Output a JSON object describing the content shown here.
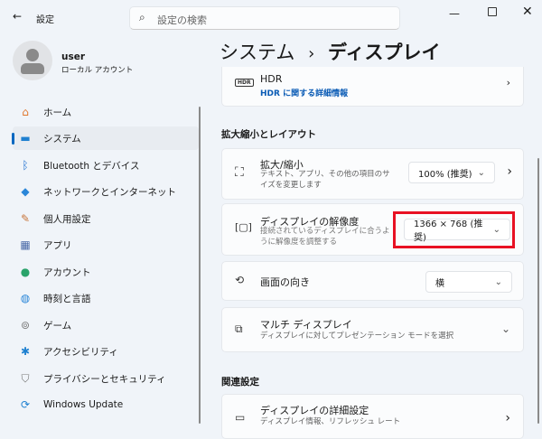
{
  "window": {
    "title": "設定",
    "search_placeholder": "設定の検索"
  },
  "user": {
    "name": "user",
    "account": "ローカル アカウント"
  },
  "nav": [
    {
      "label": "ホーム",
      "icon": "home-icon"
    },
    {
      "label": "システム",
      "icon": "system-icon"
    },
    {
      "label": "Bluetooth とデバイス",
      "icon": "bluetooth-icon"
    },
    {
      "label": "ネットワークとインターネット",
      "icon": "wifi-icon"
    },
    {
      "label": "個人用設定",
      "icon": "brush-icon"
    },
    {
      "label": "アプリ",
      "icon": "apps-icon"
    },
    {
      "label": "アカウント",
      "icon": "account-icon"
    },
    {
      "label": "時刻と言語",
      "icon": "globe-icon"
    },
    {
      "label": "ゲーム",
      "icon": "gamepad-icon"
    },
    {
      "label": "アクセシビリティ",
      "icon": "accessibility-icon"
    },
    {
      "label": "プライバシーとセキュリティ",
      "icon": "shield-icon"
    },
    {
      "label": "Windows Update",
      "icon": "update-icon"
    }
  ],
  "breadcrumb": {
    "parent": "システム",
    "sep": "›",
    "current": "ディスプレイ"
  },
  "hdr": {
    "title": "HDR",
    "link": "HDR に関する詳細情報",
    "icon_text": "HDR"
  },
  "section_scale": "拡大縮小とレイアウト",
  "scale": {
    "title": "拡大/縮小",
    "desc": "テキスト、アプリ、その他の項目のサイズを変更します",
    "value": "100% (推奨)"
  },
  "resolution": {
    "title": "ディスプレイの解像度",
    "desc": "接続されているディスプレイに合うように解像度を調整する",
    "value": "1366 × 768 (推奨)",
    "highlight": "#e81123"
  },
  "orientation": {
    "title": "画面の向き",
    "value": "横"
  },
  "multi": {
    "title": "マルチ ディスプレイ",
    "desc": "ディスプレイに対してプレゼンテーション モードを選択"
  },
  "section_related": "関連設定",
  "advanced": {
    "title": "ディスプレイの詳細設定",
    "desc": "ディスプレイ情報、リフレッシュ レート"
  }
}
